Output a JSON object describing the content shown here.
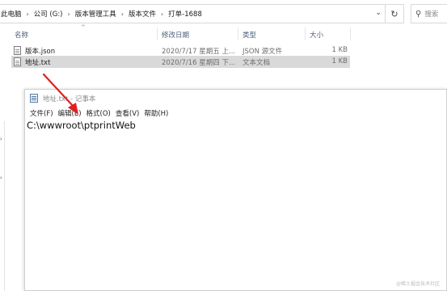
{
  "explorer": {
    "breadcrumb": [
      "此电脑",
      "公司 (G:)",
      "版本管理工具",
      "版本文件",
      "打单-1688"
    ],
    "search_placeholder": "搜索",
    "columns": [
      "名称",
      "修改日期",
      "类型",
      "大小"
    ],
    "files": [
      {
        "name": "版本.json",
        "modified": "2020/7/17 星期五 上...",
        "type": "JSON 源文件",
        "size": "1 KB",
        "selected": false
      },
      {
        "name": "地址.txt",
        "modified": "2020/7/16 星期四 下...",
        "type": "文本文档",
        "size": "1 KB",
        "selected": true
      }
    ]
  },
  "notepad": {
    "title": "地址.txt - 记事本",
    "menu": [
      "文件(F)",
      "编辑(E)",
      "格式(O)",
      "查看(V)",
      "帮助(H)"
    ],
    "content": "C:\\wwwroot\\ptprintWeb"
  },
  "annotation": {
    "color": "#e02020"
  },
  "watermark": "@稀土掘金技术社区"
}
